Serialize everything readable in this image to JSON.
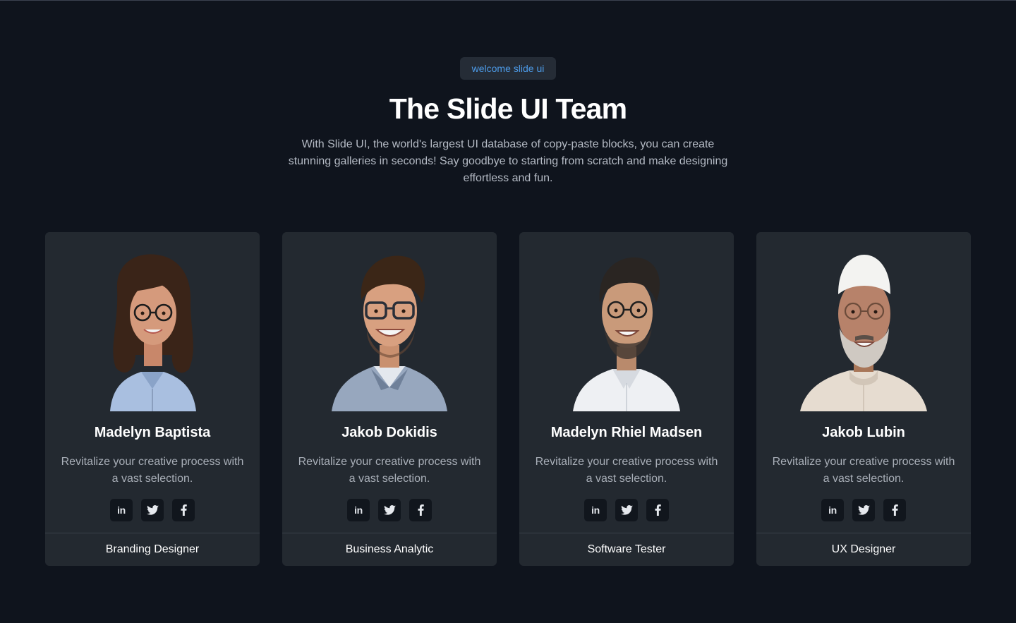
{
  "header": {
    "badge": "welcome slide ui",
    "title": "The Slide UI Team",
    "subtitle": "With Slide UI, the world's largest UI database of copy-paste blocks, you can create stunning galleries in seconds! Say goodbye to starting from scratch and make designing effortless and fun."
  },
  "colors": {
    "background": "#0f141d",
    "card": "#232930",
    "accent": "#4d9be8"
  },
  "team": [
    {
      "name": "Madelyn Baptista",
      "description": "Revitalize your creative process with a vast selection.",
      "role": "Branding Designer",
      "socials": [
        "linkedin-icon",
        "twitter-icon",
        "facebook-icon"
      ],
      "social_text": {
        "linkedin": "in"
      }
    },
    {
      "name": "Jakob Dokidis",
      "description": "Revitalize your creative process with a vast selection.",
      "role": "Business Analytic",
      "socials": [
        "linkedin-icon",
        "twitter-icon",
        "facebook-icon"
      ],
      "social_text": {
        "linkedin": "in"
      }
    },
    {
      "name": "Madelyn Rhiel Madsen",
      "description": "Revitalize your creative process with a vast selection.",
      "role": "Software Tester",
      "socials": [
        "linkedin-icon",
        "twitter-icon",
        "facebook-icon"
      ],
      "social_text": {
        "linkedin": "in"
      }
    },
    {
      "name": "Jakob Lubin",
      "description": "Revitalize your creative process with a vast selection.",
      "role": "UX Designer",
      "socials": [
        "linkedin-icon",
        "twitter-icon",
        "facebook-icon"
      ],
      "social_text": {
        "linkedin": "in"
      }
    }
  ]
}
